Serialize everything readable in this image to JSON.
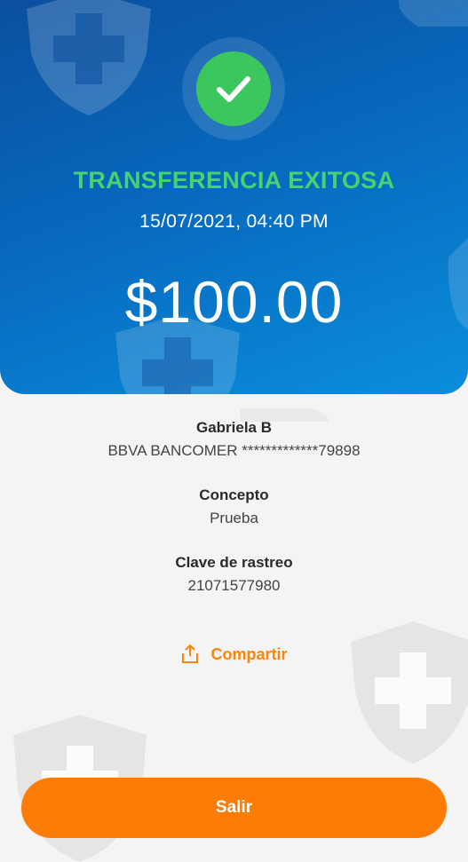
{
  "status": {
    "title": "TRANSFERENCIA EXITOSA",
    "datetime": "15/07/2021, 04:40 PM",
    "amount": "$100.00"
  },
  "recipient": {
    "name": "Gabriela B",
    "account": "BBVA BANCOMER *************79898"
  },
  "concept": {
    "label": "Concepto",
    "value": "Prueba"
  },
  "tracking": {
    "label": "Clave de rastreo",
    "value": "21071577980"
  },
  "actions": {
    "share_label": "Compartir",
    "exit_label": "Salir"
  },
  "colors": {
    "hero_gradient_start": "#0a4f9e",
    "hero_gradient_end": "#0a8edc",
    "success_green": "#45d36f",
    "accent_orange": "#f7860a",
    "button_orange": "#fd7b07"
  },
  "icons": {
    "status": "check-icon",
    "share": "share-icon",
    "watermark": "shield-cross-icon"
  }
}
